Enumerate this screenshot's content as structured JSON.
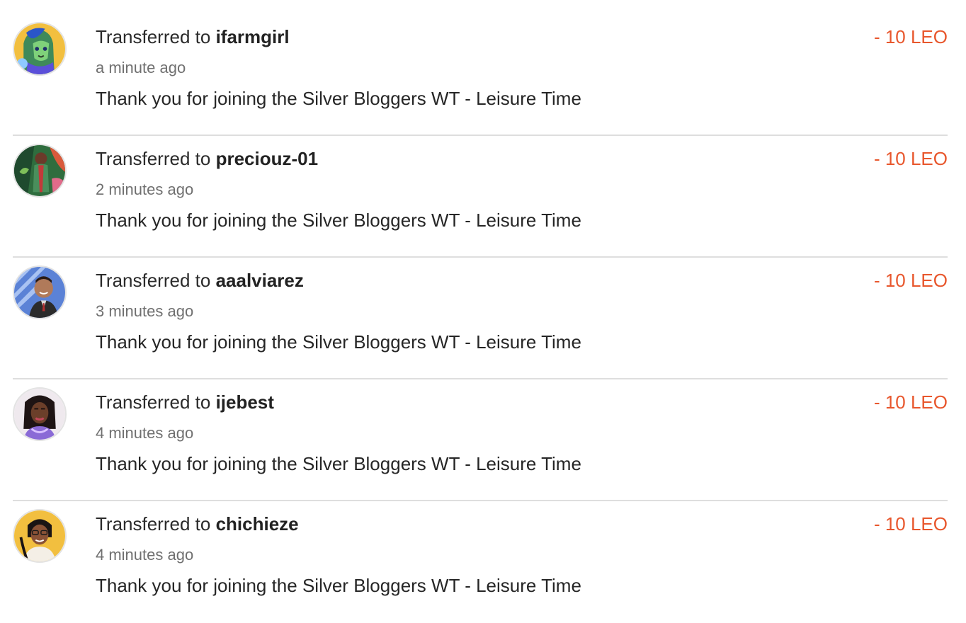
{
  "colors": {
    "amount": "#e8572d",
    "divider": "#dedede",
    "timestamp": "#707070"
  },
  "transfers": [
    {
      "prefix": "Transferred to",
      "user": "ifarmgirl",
      "time": "a minute ago",
      "memo": "Thank you for joining the Silver Bloggers WT - Leisure Time",
      "amount": "- 10 LEO",
      "avatar_icon": "avatar-ifarmgirl"
    },
    {
      "prefix": "Transferred to",
      "user": "preciouz-01",
      "time": "2 minutes ago",
      "memo": "Thank you for joining the Silver Bloggers WT - Leisure Time",
      "amount": "- 10 LEO",
      "avatar_icon": "avatar-preciouz-01"
    },
    {
      "prefix": "Transferred to",
      "user": "aaalviarez",
      "time": "3 minutes ago",
      "memo": "Thank you for joining the Silver Bloggers WT - Leisure Time",
      "amount": "- 10 LEO",
      "avatar_icon": "avatar-aaalviarez"
    },
    {
      "prefix": "Transferred to",
      "user": "ijebest",
      "time": "4 minutes ago",
      "memo": "Thank you for joining the Silver Bloggers WT - Leisure Time",
      "amount": "- 10 LEO",
      "avatar_icon": "avatar-ijebest"
    },
    {
      "prefix": "Transferred to",
      "user": "chichieze",
      "time": "4 minutes ago",
      "memo": "Thank you for joining the Silver Bloggers WT - Leisure Time",
      "amount": "- 10 LEO",
      "avatar_icon": "avatar-chichieze"
    }
  ]
}
